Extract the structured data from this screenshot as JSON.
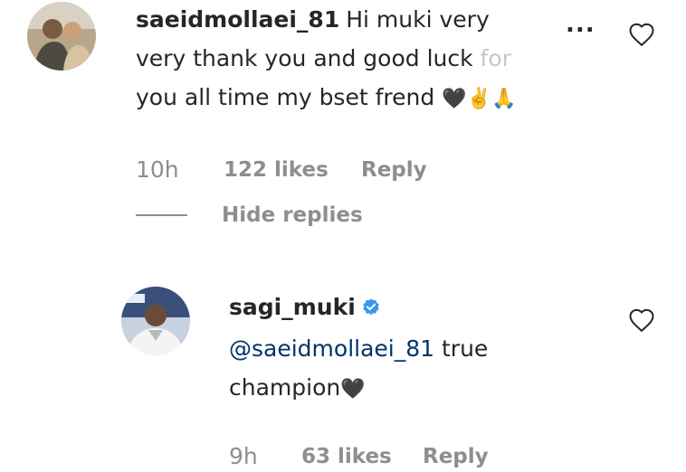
{
  "comment": {
    "username": "saeidmollaei_81",
    "text_line1": "Hi muki very",
    "text_line2": "very thank you and good luck ",
    "text_line2_faded": "for",
    "text_line3": "you all time my bset frend ",
    "emoji": "🖤✌️🙏",
    "time": "10h",
    "likes": "122 likes",
    "reply_label": "Reply",
    "more_label": "...",
    "heart_icon": "heart-outline-icon"
  },
  "hide_replies_label": "Hide replies",
  "reply": {
    "username": "sagi_muki",
    "verified_icon": "verified-badge-icon",
    "mention": "@saeidmollaei_81",
    "text_after_mention": " true",
    "text_line2": "champion",
    "emoji": "🖤",
    "time": "9h",
    "likes": "63 likes",
    "reply_label": "Reply",
    "heart_icon": "heart-outline-icon"
  },
  "colors": {
    "text": "#262626",
    "secondary": "#8e8e8e",
    "mention": "#003569",
    "verified": "#3897f0"
  }
}
